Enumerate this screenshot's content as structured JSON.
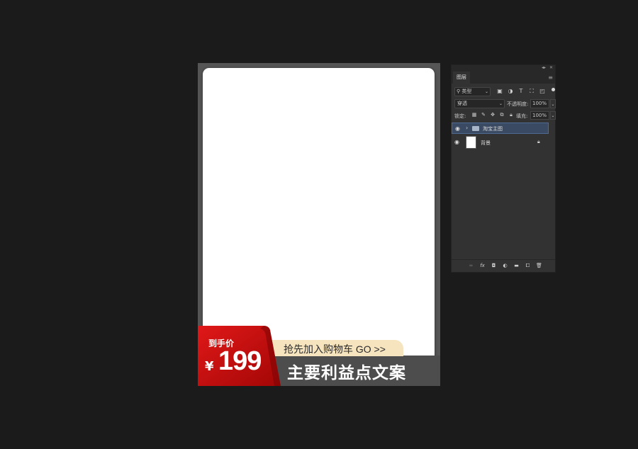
{
  "canvas": {
    "badge_label": "到手价",
    "currency": "¥",
    "price": "199",
    "slogan": "抢先加入购物车 GO >>",
    "benefit_text": "主要利益点文案",
    "colors": {
      "badge_red": "#c40d0d",
      "pill": "#f6e4bf",
      "strip": "#4d4d4d"
    }
  },
  "panel": {
    "tab_label": "图层",
    "filter": {
      "value": "类型"
    },
    "blend": {
      "value": "穿透"
    },
    "opacity": {
      "label": "不透明度:",
      "value": "100%"
    },
    "lock": {
      "label": "锁定:"
    },
    "fill": {
      "label": "填充:",
      "value": "100%"
    },
    "layers": [
      {
        "name": "淘宝主图",
        "type": "group",
        "selected": true,
        "visible": true
      },
      {
        "name": "背景",
        "type": "background",
        "locked": true,
        "visible": true
      }
    ],
    "icons": {
      "filter": [
        "image-filter-icon",
        "adjustment-filter-icon",
        "type-filter-icon",
        "shape-filter-icon",
        "smart-object-filter-icon"
      ],
      "lock": [
        "lock-transparent-icon",
        "lock-image-icon",
        "lock-position-icon",
        "lock-artboard-icon",
        "lock-all-icon"
      ],
      "bottom": [
        "link-layers-icon",
        "fx-icon",
        "mask-icon",
        "adjustment-layer-icon",
        "group-icon",
        "new-layer-icon",
        "delete-icon"
      ]
    }
  }
}
